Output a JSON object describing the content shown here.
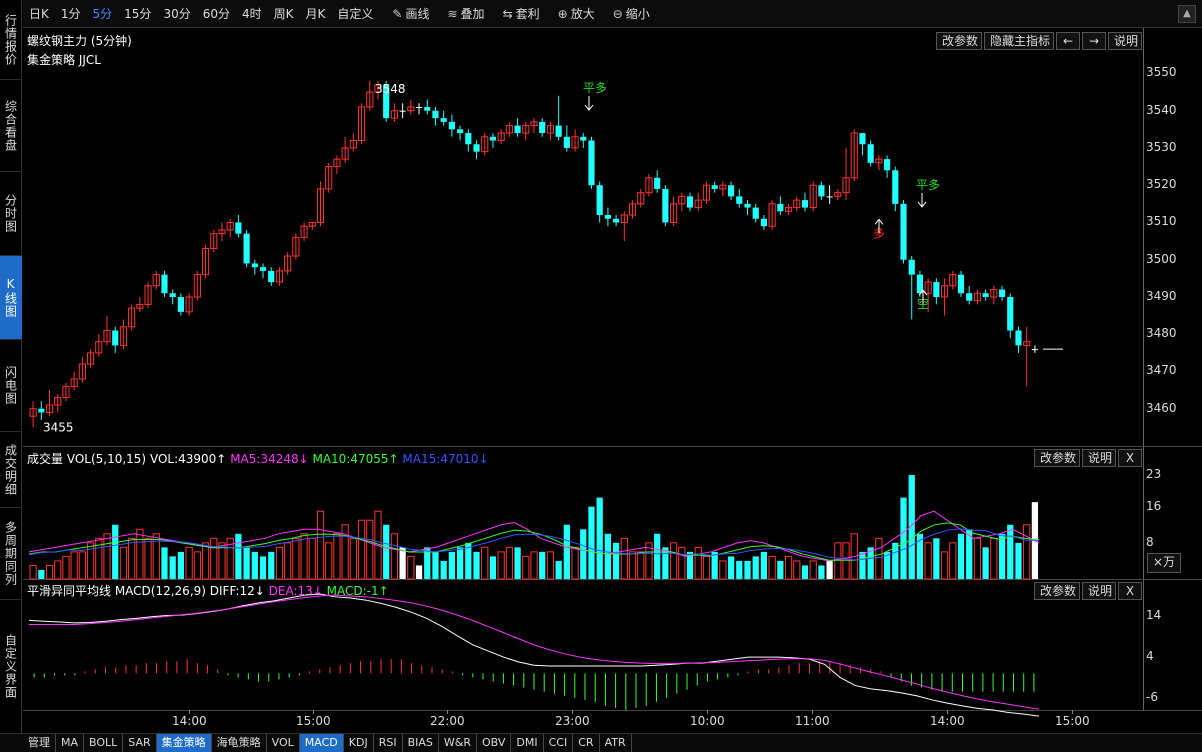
{
  "sidebar": [
    {
      "label": "行情报价",
      "active": false
    },
    {
      "label": "综合看盘",
      "active": false
    },
    {
      "label": "分时图",
      "active": false
    },
    {
      "label": "K线图",
      "active": true
    },
    {
      "label": "闪电图",
      "active": false
    },
    {
      "label": "成交明细",
      "active": false
    },
    {
      "label": "多周期同列",
      "active": false
    },
    {
      "label": "自定义界面",
      "active": false
    }
  ],
  "toolbar": {
    "periods": [
      {
        "label": "日K",
        "active": false
      },
      {
        "label": "1分",
        "active": false
      },
      {
        "label": "5分",
        "active": true
      },
      {
        "label": "15分",
        "active": false
      },
      {
        "label": "30分",
        "active": false
      },
      {
        "label": "60分",
        "active": false
      },
      {
        "label": "4时",
        "active": false
      },
      {
        "label": "周K",
        "active": false
      },
      {
        "label": "月K",
        "active": false
      },
      {
        "label": "自定义",
        "active": false
      }
    ],
    "tools": [
      {
        "label": "画线",
        "icon": "pencil-icon",
        "glyph": "✎"
      },
      {
        "label": "叠加",
        "icon": "layers-icon",
        "glyph": "≋"
      },
      {
        "label": "套利",
        "icon": "arbitrage-icon",
        "glyph": "⇆"
      },
      {
        "label": "放大",
        "icon": "zoom-in-icon",
        "glyph": "⊕"
      },
      {
        "label": "缩小",
        "icon": "zoom-out-icon",
        "glyph": "⊖"
      }
    ],
    "scroll_glyph": "▲"
  },
  "main": {
    "title": "螺纹钢主力 (5分钟)",
    "strategy": "集金策略 JJCL",
    "buttons": [
      "改参数",
      "隐藏主指标",
      "←",
      "→",
      "说明"
    ],
    "y_ticks": [
      "3550",
      "3540",
      "3530",
      "3520",
      "3510",
      "3500",
      "3490",
      "3480",
      "3470",
      "3460"
    ],
    "high_label": "3548",
    "low_label": "3455",
    "signals": [
      {
        "text": "平多",
        "color": "#22dd22"
      },
      {
        "text": "多",
        "color": "#ff2222"
      },
      {
        "text": "平多",
        "color": "#22dd22"
      },
      {
        "text": "空",
        "color": "#22dd22"
      }
    ]
  },
  "volume": {
    "label": "成交量 VOL(5,10,15)",
    "vol": "VOL:43900↑",
    "ma5": "MA5:34248↓",
    "ma10": "MA10:47055↑",
    "ma15": "MA15:47010↓",
    "buttons": [
      "改参数",
      "说明",
      "X"
    ],
    "y_ticks": [
      "23",
      "16",
      "8"
    ],
    "unit": "×万"
  },
  "macd": {
    "label": "平滑异同平均线 MACD(12,26,9)",
    "diff": "DIFF:12↓",
    "dea": "DEA:13↓",
    "macdv": "MACD:-1↑",
    "buttons": [
      "改参数",
      "说明",
      "X"
    ],
    "y_ticks": [
      "14",
      "4",
      "-6"
    ]
  },
  "x_ticks": [
    "14:00",
    "15:00",
    "22:00",
    "23:00",
    "10:00",
    "11:00",
    "14:00",
    "15:00"
  ],
  "bottom_tabs": [
    {
      "label": "管理",
      "active": false
    },
    {
      "label": "MA",
      "active": false
    },
    {
      "label": "BOLL",
      "active": false
    },
    {
      "label": "SAR",
      "active": false
    },
    {
      "label": "集金策略",
      "active": true
    },
    {
      "label": "海龟策略",
      "active": false
    },
    {
      "label": "VOL",
      "active": false
    },
    {
      "label": "MACD",
      "active": true
    },
    {
      "label": "KDJ",
      "active": false
    },
    {
      "label": "RSI",
      "active": false
    },
    {
      "label": "BIAS",
      "active": false
    },
    {
      "label": "W&R",
      "active": false
    },
    {
      "label": "OBV",
      "active": false
    },
    {
      "label": "DMI",
      "active": false
    },
    {
      "label": "CCI",
      "active": false
    },
    {
      "label": "CR",
      "active": false
    },
    {
      "label": "ATR",
      "active": false
    }
  ],
  "chart_data": {
    "type": "candlestick",
    "y_range": [
      3450,
      3552
    ],
    "colors": {
      "up": "#ff3333",
      "down": "#22ffff",
      "doji": "#ffffff"
    },
    "candles": [
      [
        3458,
        3460,
        3462,
        3455
      ],
      [
        3460,
        3459,
        3462,
        3457
      ],
      [
        3459,
        3461,
        3465,
        3458
      ],
      [
        3461,
        3463,
        3464,
        3459
      ],
      [
        3463,
        3466,
        3467,
        3462
      ],
      [
        3466,
        3468,
        3470,
        3465
      ],
      [
        3468,
        3472,
        3474,
        3467
      ],
      [
        3472,
        3475,
        3476,
        3471
      ],
      [
        3475,
        3478,
        3480,
        3474
      ],
      [
        3478,
        3481,
        3485,
        3477
      ],
      [
        3481,
        3477,
        3482,
        3475
      ],
      [
        3477,
        3482,
        3484,
        3476
      ],
      [
        3482,
        3487,
        3488,
        3481
      ],
      [
        3487,
        3488,
        3490,
        3486
      ],
      [
        3488,
        3493,
        3494,
        3487
      ],
      [
        3493,
        3496,
        3497,
        3492
      ],
      [
        3496,
        3491,
        3497,
        3490
      ],
      [
        3491,
        3490,
        3492,
        3488
      ],
      [
        3490,
        3486,
        3491,
        3485
      ],
      [
        3486,
        3490,
        3491,
        3485
      ],
      [
        3490,
        3496,
        3497,
        3489
      ],
      [
        3496,
        3503,
        3504,
        3495
      ],
      [
        3503,
        3507,
        3508,
        3502
      ],
      [
        3507,
        3508,
        3510,
        3505
      ],
      [
        3508,
        3510,
        3511,
        3506
      ],
      [
        3510,
        3507,
        3512,
        3506
      ],
      [
        3507,
        3499,
        3508,
        3498
      ],
      [
        3499,
        3498,
        3500,
        3496
      ],
      [
        3498,
        3497,
        3499,
        3495
      ],
      [
        3497,
        3494,
        3498,
        3493
      ],
      [
        3494,
        3497,
        3498,
        3493
      ],
      [
        3497,
        3501,
        3502,
        3496
      ],
      [
        3501,
        3506,
        3507,
        3500
      ],
      [
        3506,
        3509,
        3510,
        3505
      ],
      [
        3509,
        3510,
        3510,
        3508
      ],
      [
        3510,
        3519,
        3521,
        3509
      ],
      [
        3519,
        3525,
        3526,
        3518
      ],
      [
        3525,
        3527,
        3528,
        3523
      ],
      [
        3527,
        3530,
        3533,
        3526
      ],
      [
        3530,
        3532,
        3534,
        3529
      ],
      [
        3532,
        3541,
        3542,
        3531
      ],
      [
        3541,
        3545,
        3548,
        3540
      ],
      [
        3545,
        3547,
        3548,
        3543
      ],
      [
        3547,
        3538,
        3548,
        3537
      ],
      [
        3538,
        3540,
        3542,
        3537
      ],
      [
        3540,
        3540,
        3542,
        3538
      ],
      [
        3540,
        3541,
        3543,
        3539
      ],
      [
        3541,
        3541,
        3542,
        3539
      ],
      [
        3541,
        3540,
        3543,
        3539
      ],
      [
        3540,
        3538,
        3541,
        3536
      ],
      [
        3538,
        3537,
        3540,
        3536
      ],
      [
        3537,
        3535,
        3539,
        3533
      ],
      [
        3535,
        3534,
        3536,
        3532
      ],
      [
        3534,
        3531,
        3535,
        3529
      ],
      [
        3531,
        3529,
        3532,
        3527
      ],
      [
        3529,
        3533,
        3534,
        3528
      ],
      [
        3533,
        3532,
        3534,
        3530
      ],
      [
        3532,
        3534,
        3535,
        3531
      ],
      [
        3534,
        3536,
        3537,
        3533
      ],
      [
        3536,
        3534,
        3538,
        3533
      ],
      [
        3534,
        3536,
        3537,
        3532
      ],
      [
        3536,
        3537,
        3538,
        3534
      ],
      [
        3537,
        3534,
        3538,
        3533
      ],
      [
        3534,
        3536,
        3537,
        3532
      ],
      [
        3536,
        3533,
        3544,
        3532
      ],
      [
        3533,
        3530,
        3536,
        3529
      ],
      [
        3530,
        3533,
        3535,
        3529
      ],
      [
        3533,
        3532,
        3534,
        3530
      ],
      [
        3532,
        3520,
        3533,
        3519
      ],
      [
        3520,
        3512,
        3521,
        3510
      ],
      [
        3512,
        3511,
        3514,
        3509
      ],
      [
        3511,
        3510,
        3512,
        3509
      ],
      [
        3510,
        3512,
        3513,
        3505
      ],
      [
        3512,
        3515,
        3516,
        3511
      ],
      [
        3515,
        3518,
        3519,
        3514
      ],
      [
        3518,
        3522,
        3523,
        3517
      ],
      [
        3522,
        3519,
        3524,
        3518
      ],
      [
        3519,
        3510,
        3520,
        3509
      ],
      [
        3510,
        3515,
        3517,
        3509
      ],
      [
        3515,
        3517,
        3518,
        3513
      ],
      [
        3517,
        3514,
        3518,
        3513
      ],
      [
        3514,
        3516,
        3518,
        3513
      ],
      [
        3516,
        3520,
        3521,
        3515
      ],
      [
        3520,
        3519,
        3521,
        3518
      ],
      [
        3519,
        3520,
        3521,
        3517
      ],
      [
        3520,
        3517,
        3521,
        3516
      ],
      [
        3517,
        3515,
        3519,
        3514
      ],
      [
        3515,
        3514,
        3516,
        3512
      ],
      [
        3514,
        3511,
        3515,
        3510
      ],
      [
        3511,
        3509,
        3512,
        3508
      ],
      [
        3509,
        3515,
        3516,
        3508
      ],
      [
        3515,
        3513,
        3517,
        3512
      ],
      [
        3513,
        3514,
        3515,
        3512
      ],
      [
        3514,
        3516,
        3517,
        3513
      ],
      [
        3516,
        3514,
        3518,
        3513
      ],
      [
        3514,
        3520,
        3521,
        3513
      ],
      [
        3520,
        3517,
        3521,
        3516
      ],
      [
        3517,
        3517,
        3520,
        3515
      ],
      [
        3517,
        3518,
        3519,
        3516
      ],
      [
        3518,
        3522,
        3530,
        3516
      ],
      [
        3522,
        3534,
        3535,
        3521
      ],
      [
        3534,
        3531,
        3534,
        3528
      ],
      [
        3531,
        3526,
        3532,
        3525
      ],
      [
        3526,
        3527,
        3528,
        3524
      ],
      [
        3527,
        3524,
        3528,
        3522
      ],
      [
        3524,
        3515,
        3525,
        3513
      ],
      [
        3515,
        3500,
        3516,
        3499
      ],
      [
        3500,
        3496,
        3501,
        3484
      ],
      [
        3496,
        3491,
        3497,
        3490
      ],
      [
        3491,
        3494,
        3495,
        3486
      ],
      [
        3494,
        3490,
        3495,
        3488
      ],
      [
        3490,
        3493,
        3495,
        3485
      ],
      [
        3493,
        3496,
        3497,
        3492
      ],
      [
        3496,
        3491,
        3497,
        3490
      ],
      [
        3491,
        3489,
        3493,
        3488
      ],
      [
        3489,
        3491,
        3492,
        3488
      ],
      [
        3491,
        3490,
        3492,
        3489
      ],
      [
        3490,
        3492,
        3493,
        3488
      ],
      [
        3492,
        3490,
        3493,
        3489
      ],
      [
        3490,
        3481,
        3491,
        3479
      ],
      [
        3481,
        3477,
        3482,
        3475
      ],
      [
        3477,
        3478,
        3482,
        3466
      ],
      [
        3476,
        3476,
        3477,
        3475
      ]
    ],
    "volume": [
      3,
      2,
      3,
      4,
      5,
      6,
      6,
      8,
      9,
      10,
      12,
      7,
      9,
      11,
      9,
      10,
      7,
      5,
      6,
      7,
      6,
      8,
      9,
      8,
      9,
      10,
      7,
      6,
      5,
      6,
      7,
      8,
      9,
      10,
      9,
      15,
      8,
      10,
      12,
      9,
      13,
      13,
      15,
      12,
      10,
      7,
      5,
      3,
      7,
      6,
      4,
      6,
      7,
      8,
      6,
      7,
      5,
      6,
      7,
      7,
      5,
      6,
      6,
      6,
      4,
      12,
      7,
      11,
      16,
      18,
      10,
      8,
      9,
      6,
      6,
      8,
      10,
      7,
      8,
      7,
      6,
      7,
      5,
      6,
      4,
      5,
      4,
      4,
      5,
      6,
      5,
      4,
      5,
      4,
      3,
      4,
      3,
      4,
      8,
      8,
      10,
      6,
      7,
      9,
      6,
      8,
      18,
      23,
      10,
      8,
      9,
      6,
      8,
      10,
      11,
      9,
      7,
      9,
      10,
      12,
      8,
      12,
      17
    ],
    "macd_hist": [
      -1,
      -1,
      -0.5,
      -0.5,
      -0.5,
      0.5,
      1,
      1.5,
      1.5,
      2,
      2,
      2.5,
      2.5,
      3,
      3,
      3.5,
      2.5,
      2,
      1,
      -0.5,
      -1,
      -1.5,
      -2,
      -2,
      -1.5,
      -1,
      -0.5,
      0.5,
      1,
      1.5,
      2,
      2.5,
      3,
      3,
      3.5,
      3.5,
      3.5,
      2.5,
      2,
      1.5,
      1,
      0.5,
      -0.5,
      -1,
      -1.5,
      -2,
      -2.5,
      -3,
      -3.5,
      -4,
      -4.5,
      -5,
      -5.5,
      -6,
      -6.5,
      -7,
      -8,
      -8.5,
      -9,
      -8.5,
      -8,
      -7,
      -6,
      -5,
      -4,
      -3,
      -2,
      -1.5,
      -1,
      -0.5,
      0.5,
      1,
      1,
      1.5,
      2,
      2.5,
      2.5,
      3,
      3,
      2.5,
      2,
      1.5,
      1,
      0.5,
      -1,
      -2,
      -3,
      -3.5,
      -4,
      -4.5,
      -4.5,
      -4.5,
      -4.5,
      -4.5,
      -4.5,
      -4.5,
      -4.5,
      -4.5,
      -4.5
    ],
    "diff_line": [
      13,
      12.8,
      12.6,
      12.4,
      12.5,
      12.8,
      13.2,
      13.5,
      13.9,
      14.2,
      14.3,
      14.7,
      15.2,
      15.8,
      16.6,
      17.3,
      17.8,
      18.5,
      19.2,
      19.5,
      18.8,
      18.5,
      18,
      17.2,
      16.2,
      15,
      13.5,
      11.5,
      9.2,
      7,
      5.5,
      4,
      2.8,
      2,
      1.8,
      1.8,
      1.8,
      1.8,
      1.8,
      1.8,
      1.8,
      2,
      2.2,
      2.5,
      2.5,
      3,
      3.5,
      4,
      4,
      4,
      3.8,
      3.5,
      2.2,
      -1,
      -3,
      -3.8,
      -4.2,
      -4.8,
      -5.5,
      -6.5,
      -7.3,
      -8,
      -8.6,
      -9,
      -9.6,
      -10,
      -10.5
    ],
    "dea_line": [
      12,
      12,
      12,
      12,
      12.2,
      12.5,
      12.8,
      13.2,
      13.6,
      14,
      14.4,
      14.8,
      15.3,
      15.8,
      16.4,
      17,
      17.6,
      18.1,
      18.6,
      19,
      19.2,
      19,
      18.8,
      18.4,
      17.9,
      17.3,
      16.5,
      15.5,
      14.3,
      13,
      11.5,
      10,
      8.5,
      7,
      5.8,
      4.8,
      4,
      3.4,
      3,
      2.7,
      2.5,
      2.4,
      2.4,
      2.5,
      2.6,
      2.7,
      2.9,
      3.1,
      3.3,
      3.5,
      3.6,
      3.6,
      3.2,
      2.3,
      1.3,
      0.3,
      -0.6,
      -1.6,
      -2.6,
      -3.7,
      -4.6,
      -5.5,
      -6.3,
      -7,
      -7.6,
      -8.2,
      -8.8
    ],
    "vol_ma5": [
      6,
      6.5,
      7,
      7.5,
      8,
      8.5,
      9,
      9.5,
      10,
      9.5,
      9,
      8.5,
      8,
      7.5,
      7,
      7.5,
      8,
      8.5,
      9,
      10,
      10.5,
      11,
      11,
      10.5,
      10,
      9,
      8,
      7,
      6.5,
      6,
      6.5,
      7,
      8,
      9,
      10,
      11,
      12,
      12.5,
      11,
      9,
      8,
      7,
      6.5,
      6,
      5.5,
      6,
      6.5,
      7,
      6.5,
      6,
      5,
      5.5,
      6,
      7,
      8,
      8.5,
      8,
      7,
      6,
      5,
      4.5,
      4,
      4.5,
      5,
      6,
      7,
      9,
      11,
      14,
      15,
      13,
      11,
      9,
      9.5,
      10,
      11,
      9.5,
      8
    ]
  }
}
